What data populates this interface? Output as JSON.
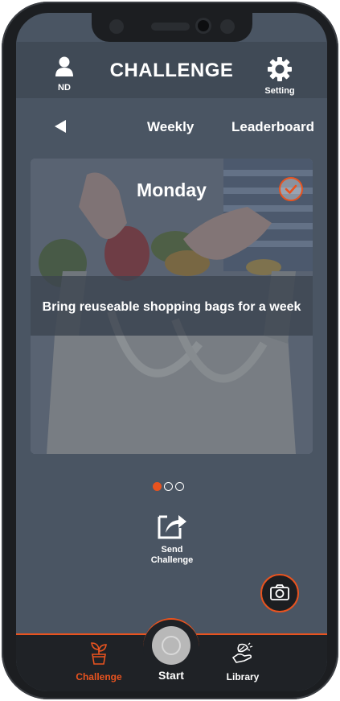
{
  "header": {
    "title": "CHALLENGE",
    "user_label": "ND",
    "setting_label": "Setting"
  },
  "nav": {
    "weekly_label": "Weekly",
    "leaderboard_label": "Leaderboard"
  },
  "card": {
    "day": "Monday",
    "challenge_text": "Bring reuseable shopping bags for a week",
    "completed": true
  },
  "pagination": {
    "total": 3,
    "active_index": 0
  },
  "actions": {
    "send_label_line1": "Send",
    "send_label_line2": "Challenge"
  },
  "bottom_nav": {
    "challenge_label": "Challenge",
    "start_label": "Start",
    "library_label": "Library"
  },
  "colors": {
    "accent": "#e8531f",
    "screen_bg": "#4a5563",
    "header_bg": "#404a56",
    "bottom_bar_bg": "#1f2226"
  },
  "icons": [
    "user-icon",
    "gear-icon",
    "back-arrow-icon",
    "checkmark-icon",
    "share-icon",
    "camera-icon",
    "plant-icon",
    "hand-leaf-icon"
  ]
}
